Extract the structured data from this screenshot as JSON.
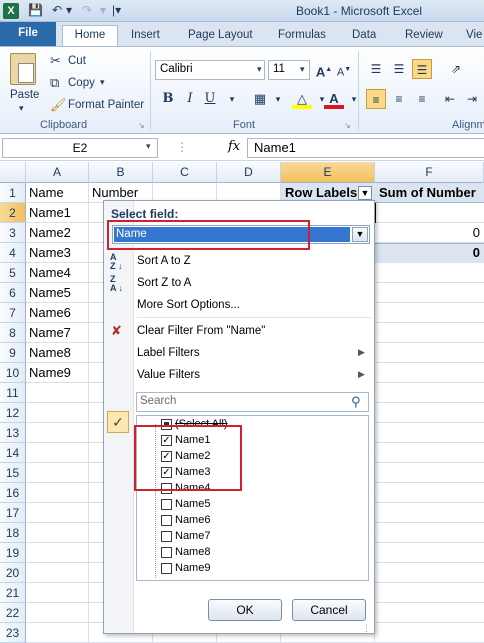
{
  "window": {
    "title": "Book1  -  Microsoft Excel"
  },
  "tabs": [
    "File",
    "Home",
    "Insert",
    "Page Layout",
    "Formulas",
    "Data",
    "Review",
    "Vie"
  ],
  "ribbon": {
    "clipboard": {
      "paste": "Paste",
      "cut": "Cut",
      "copy": "Copy",
      "copy_arrow": "▾",
      "format_painter": "Format Painter",
      "label": "Clipboard"
    },
    "font": {
      "name": "Calibri",
      "size": "11",
      "label": "Font",
      "bold": "B",
      "italic": "I",
      "underline": "U"
    },
    "alignment": {
      "label": "Alignm"
    }
  },
  "formula_bar": {
    "name_box": "E2",
    "fx": "fx",
    "content": "Name1"
  },
  "columns": [
    "A",
    "B",
    "C",
    "D",
    "E",
    "F"
  ],
  "rows": [
    "1",
    "2",
    "3",
    "4",
    "5",
    "6",
    "7",
    "8",
    "9",
    "10",
    "11",
    "12",
    "13",
    "14",
    "15",
    "16",
    "17",
    "18",
    "19",
    "20",
    "21",
    "22",
    "23"
  ],
  "cells": {
    "A": [
      "Name",
      "Name1",
      "Name2",
      "Name3",
      "Name4",
      "Name5",
      "Name6",
      "Name7",
      "Name8",
      "Name9"
    ],
    "B1": "Number",
    "E1": "Row Labels",
    "F1": "Sum of Number",
    "F3": "0",
    "F4": "0"
  },
  "panel": {
    "select_field_label": "Select field:",
    "select_field_value": "Name",
    "sort_az": "Sort A to Z",
    "sort_za": "Sort Z to A",
    "more_sort": "More Sort Options...",
    "clear_filter": "Clear Filter From \"Name\"",
    "label_filters": "Label Filters",
    "value_filters": "Value Filters",
    "search_placeholder": "Search",
    "items": [
      {
        "label": "(Select All)",
        "checked": "partial"
      },
      {
        "label": "Name1",
        "checked": "yes"
      },
      {
        "label": "Name2",
        "checked": "yes"
      },
      {
        "label": "Name3",
        "checked": "yes"
      },
      {
        "label": "Name4",
        "checked": "no"
      },
      {
        "label": "Name5",
        "checked": "no"
      },
      {
        "label": "Name6",
        "checked": "no"
      },
      {
        "label": "Name7",
        "checked": "no"
      },
      {
        "label": "Name8",
        "checked": "no"
      },
      {
        "label": "Name9",
        "checked": "no"
      }
    ],
    "ok": "OK",
    "cancel": "Cancel"
  },
  "colors": {
    "accent": "#2a6aa8",
    "highlight": "#d2202f",
    "selection": "#3476d0"
  }
}
